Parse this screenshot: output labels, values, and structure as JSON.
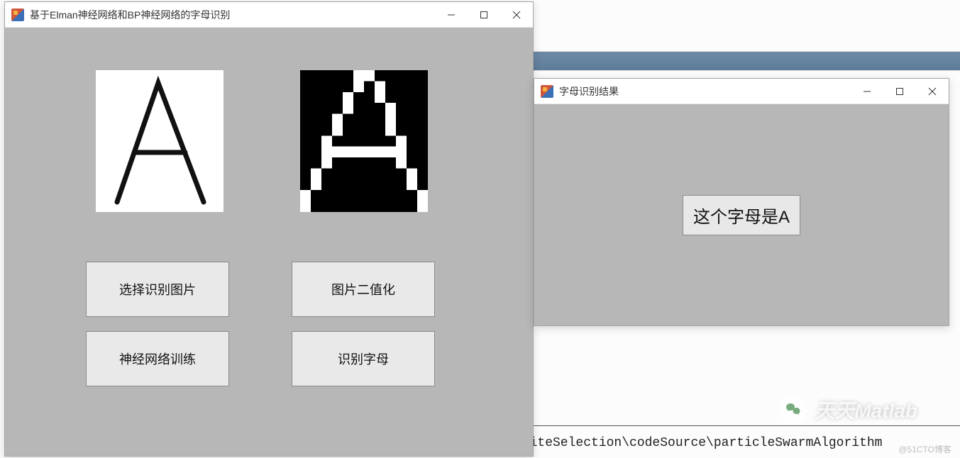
{
  "main_window": {
    "title": "基于Elman神经网络和BP神经网络的字母识别",
    "buttons": {
      "select_image": "选择识别图片",
      "binarize": "图片二值化",
      "train_nn": "神经网络训练",
      "recognize": "识别字母"
    }
  },
  "result_window": {
    "title": "字母识别结果",
    "message": "这个字母是A"
  },
  "background": {
    "path_fragment": "_siteSelection\\codeSource\\particleSwarmAlgorithm",
    "site_watermark": "@51CTO博客",
    "channel_name": "天天Matlab"
  }
}
